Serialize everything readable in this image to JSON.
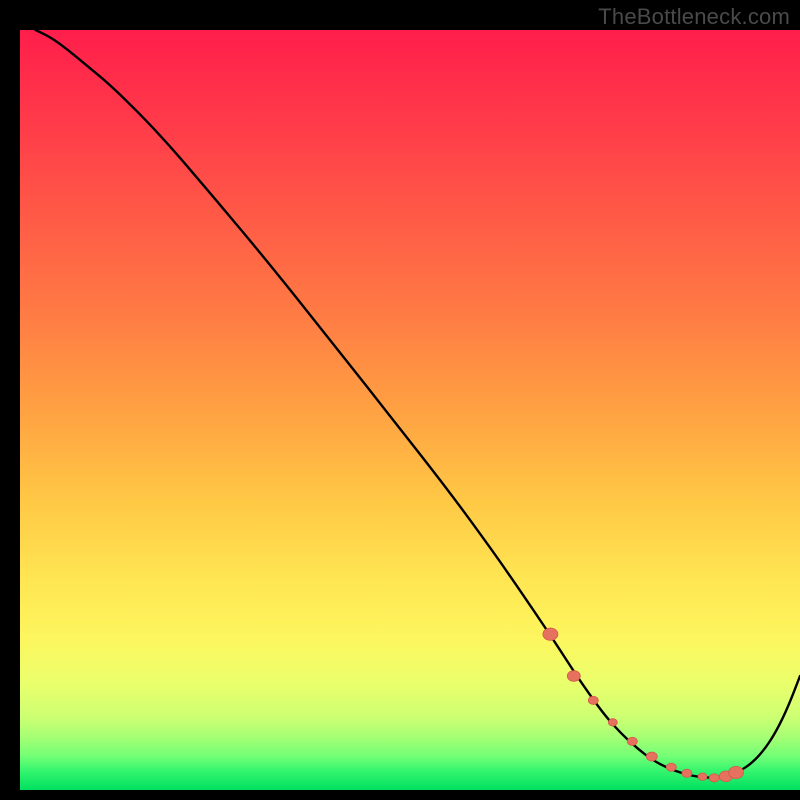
{
  "watermark": "TheBottleneck.com",
  "colors": {
    "frame": "#000000",
    "curve_stroke": "#000000",
    "marker_fill": "#e6715f",
    "marker_stroke": "#d35a49",
    "gradient_stops": [
      {
        "offset": 0.0,
        "color": "#ff1e4b"
      },
      {
        "offset": 0.12,
        "color": "#ff3a4a"
      },
      {
        "offset": 0.25,
        "color": "#ff5b46"
      },
      {
        "offset": 0.38,
        "color": "#ff7d44"
      },
      {
        "offset": 0.5,
        "color": "#ffa142"
      },
      {
        "offset": 0.62,
        "color": "#ffc845"
      },
      {
        "offset": 0.72,
        "color": "#ffe552"
      },
      {
        "offset": 0.8,
        "color": "#fdf65e"
      },
      {
        "offset": 0.86,
        "color": "#eaff6c"
      },
      {
        "offset": 0.905,
        "color": "#ccff72"
      },
      {
        "offset": 0.93,
        "color": "#a6ff74"
      },
      {
        "offset": 0.955,
        "color": "#74ff76"
      },
      {
        "offset": 0.975,
        "color": "#34f56e"
      },
      {
        "offset": 1.0,
        "color": "#00e060"
      }
    ]
  },
  "chart_data": {
    "type": "line",
    "title": "",
    "xlabel": "",
    "ylabel": "",
    "xlim": [
      0,
      100
    ],
    "ylim": [
      0,
      100
    ],
    "grid": false,
    "series": [
      {
        "name": "bottleneck-curve",
        "x": [
          2,
          4,
          6,
          8,
          12,
          18,
          25,
          32,
          40,
          48,
          55,
          60,
          63,
          66,
          69,
          71,
          73,
          75,
          77,
          79,
          81,
          83,
          85,
          87,
          89,
          91,
          92.5,
          94,
          95.5,
          97,
          98.5,
          100
        ],
        "values": [
          100,
          99,
          97.5,
          95.8,
          92.4,
          86.2,
          77.8,
          69.2,
          58.9,
          48.5,
          39.3,
          32.3,
          27.9,
          23.4,
          18.8,
          15.6,
          12.6,
          9.8,
          7.5,
          5.6,
          4.0,
          2.9,
          2.15,
          1.7,
          1.6,
          2.0,
          2.6,
          3.7,
          5.4,
          7.8,
          11.0,
          15.0
        ],
        "note": "y-values represent relative height of the curve inside the colored panel (0 = bottom edge of panel, 100 = top edge). x-values represent relative horizontal position across the panel width (0 = left edge, 100 = right edge)."
      }
    ],
    "markers": {
      "name": "highlight-dots",
      "x": [
        68,
        71,
        73.5,
        76,
        78.5,
        81,
        83.5,
        85.5,
        87.5,
        89,
        90.5,
        91.8
      ],
      "values": [
        20.5,
        15.0,
        11.8,
        8.9,
        6.4,
        4.4,
        3.0,
        2.2,
        1.75,
        1.6,
        1.8,
        2.3
      ],
      "sizes": [
        7.5,
        6.5,
        5.0,
        4.5,
        5.0,
        5.5,
        5.0,
        5.0,
        4.5,
        5.0,
        6.5,
        7.5
      ]
    }
  }
}
